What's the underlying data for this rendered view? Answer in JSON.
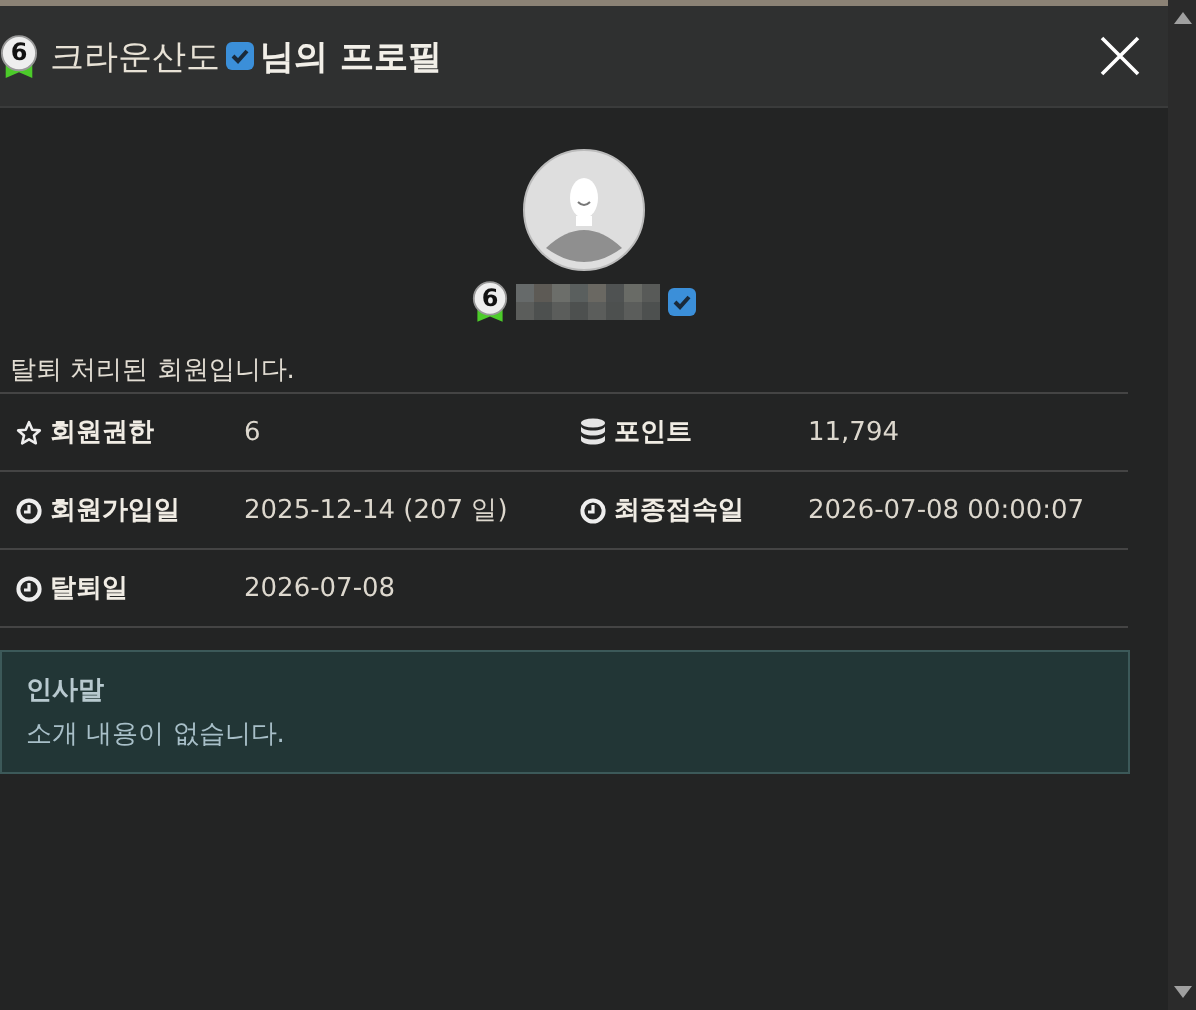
{
  "dialog": {
    "level": "6",
    "title_name": "크라운산도",
    "title_suffix": "님의 프로필"
  },
  "profile": {
    "level": "6",
    "verified": true
  },
  "notice": "탈퇴 처리된 회원입니다.",
  "info_rows": [
    {
      "fields": [
        {
          "kind": "rank",
          "label": "회원권한",
          "value": "6"
        },
        {
          "kind": "points",
          "label": "포인트",
          "value": "11,794"
        }
      ]
    },
    {
      "fields": [
        {
          "kind": "date",
          "label": "회원가입일",
          "value": "2025-12-14 (207 일)"
        },
        {
          "kind": "date",
          "label": "최종접속일",
          "value": "2026-07-08 00:00:07"
        }
      ]
    },
    {
      "fields": [
        {
          "kind": "date",
          "label": "탈퇴일",
          "value": "2026-07-08"
        }
      ]
    }
  ],
  "greeting": {
    "title": "인사말",
    "text": "소개 내용이 없습니다."
  }
}
